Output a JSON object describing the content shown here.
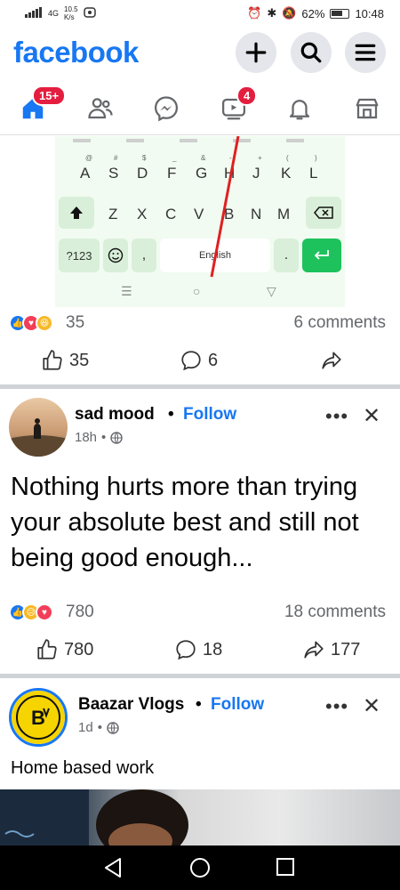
{
  "status": {
    "network": "4G",
    "speed": "10.5",
    "speed_unit": "K/s",
    "battery": "62%",
    "time": "10:48"
  },
  "header": {
    "logo": "facebook"
  },
  "nav": {
    "home_badge": "15+",
    "video_badge": "4"
  },
  "keyboard": {
    "row2": [
      "A",
      "S",
      "D",
      "F",
      "G",
      "H",
      "J",
      "K",
      "L"
    ],
    "row2_hints": [
      "@",
      "#",
      "$",
      "_",
      "&",
      "-",
      "+",
      "(",
      ")"
    ],
    "row3": [
      "Z",
      "X",
      "C",
      "V",
      "B",
      "N",
      "M"
    ],
    "sym_key": "?123",
    "comma": ",",
    "space_label": "English",
    "period": "."
  },
  "post1": {
    "reaction_count": "35",
    "comments": "6 comments",
    "like_count": "35",
    "comment_count": "6"
  },
  "post2": {
    "author": "sad mood",
    "follow": "Follow",
    "time": "18h",
    "text": "Nothing hurts more than trying your absolute best and still not being good enough...",
    "reaction_count": "780",
    "comments": "18 comments",
    "like_count": "780",
    "comment_count": "18",
    "share_count": "177"
  },
  "post3": {
    "author": "Baazar Vlogs",
    "follow": "Follow",
    "time": "1d",
    "text": "Home based work"
  },
  "colors": {
    "brand": "#1877f2",
    "badge": "#e41e3f",
    "enter_key": "#1dc25c"
  }
}
